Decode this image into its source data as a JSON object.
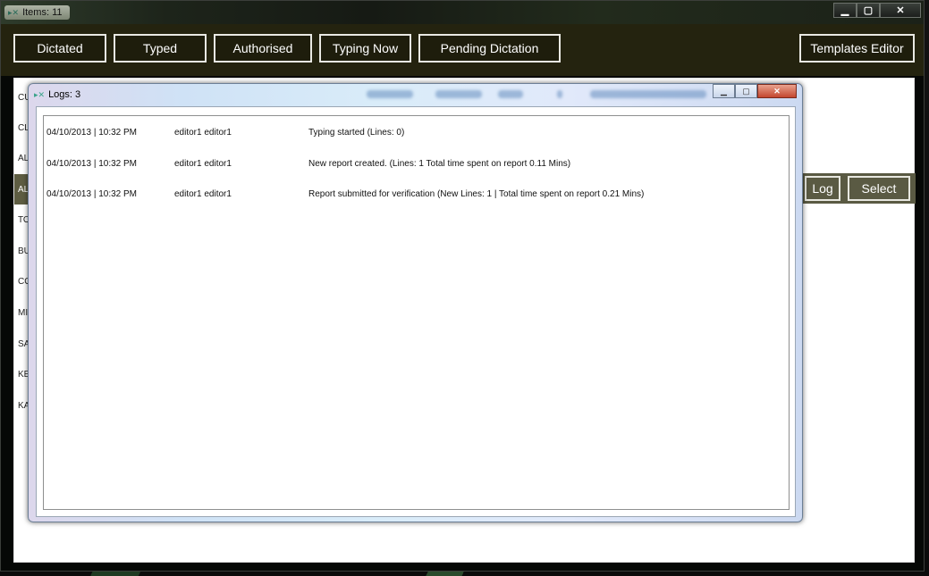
{
  "window": {
    "title": "Items: 11",
    "controls": [
      "minimize",
      "maximize",
      "close"
    ]
  },
  "toolbar": {
    "buttons": [
      "Dictated",
      "Typed",
      "Authorised",
      "Typing Now",
      "Pending Dictation"
    ],
    "templates_editor": "Templates Editor"
  },
  "list": {
    "rows": [
      "CU",
      "CL",
      "AL",
      "AL",
      "TO",
      "BU",
      "CO",
      "MI",
      "SA",
      "KE",
      "KA"
    ],
    "selected_index": 3
  },
  "actions": {
    "log": "Log",
    "select": "Select"
  },
  "dialog": {
    "title": "Logs: 3",
    "entries": [
      {
        "date": "04/10/2013 | 10:32 PM",
        "user": "editor1 editor1",
        "message": "Typing started (Lines: 0)"
      },
      {
        "date": "04/10/2013 | 10:32 PM",
        "user": "editor1 editor1",
        "message": "New report created. (Lines: 1 Total time spent on report 0.11 Mins)"
      },
      {
        "date": "04/10/2013 | 10:32 PM",
        "user": "editor1 editor1",
        "message": "Report submitted for verification (New Lines: 1 | Total time spent on report 0.21 Mins)"
      }
    ]
  },
  "colors": {
    "toolbar_bg": "#24230f",
    "accent_olive": "#5e5d42",
    "dialog_close": "#c3462e"
  }
}
